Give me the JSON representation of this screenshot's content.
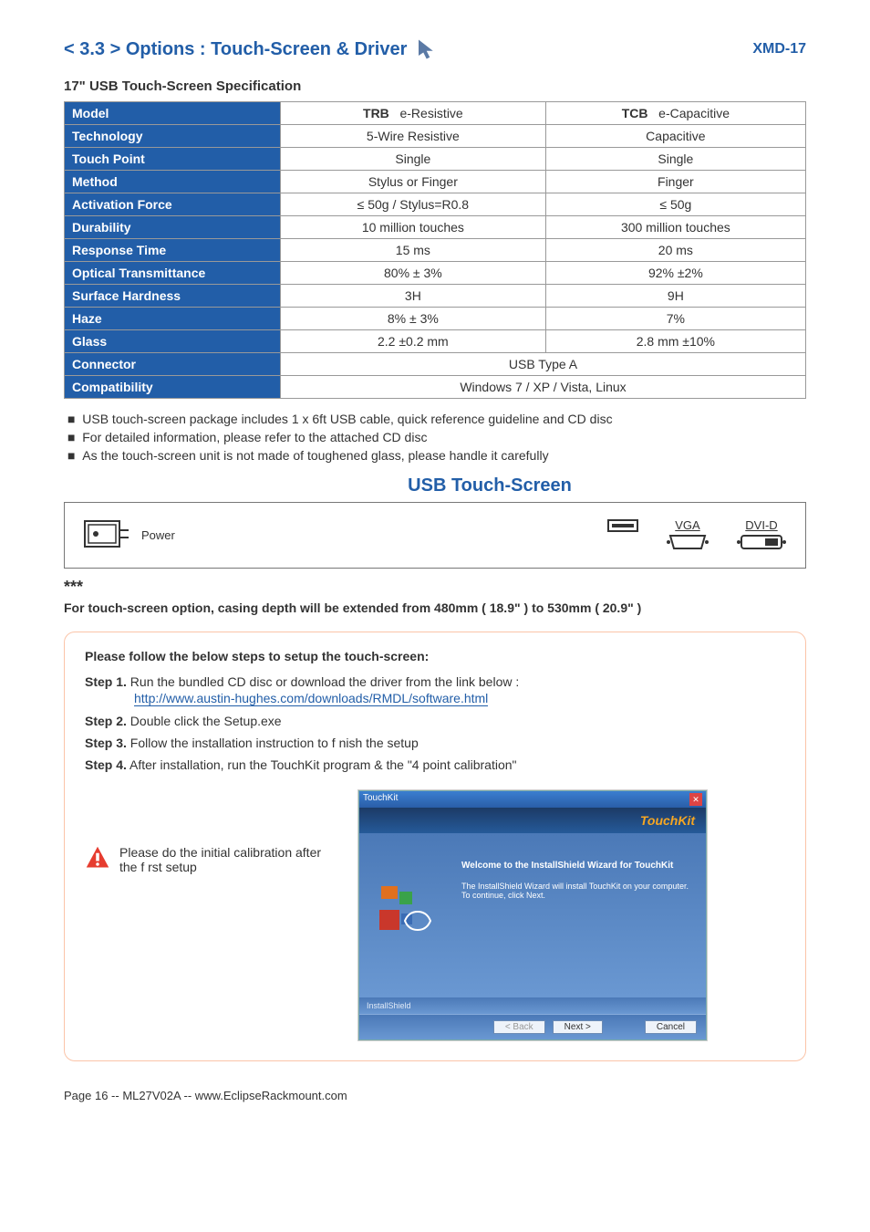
{
  "header": {
    "section_title": "< 3.3 > Options : Touch-Screen & Driver",
    "model_code": "XMD-17"
  },
  "spec_heading": "17\" USB Touch-Screen Specification",
  "table": {
    "rows": [
      {
        "label": "Model",
        "col1_bold": "TRB",
        "col1_rest": "e-Resistive",
        "col2_bold": "TCB",
        "col2_rest": "e-Capacitive"
      },
      {
        "label": "Technology",
        "col1": "5-Wire Resistive",
        "col2": "Capacitive"
      },
      {
        "label": "Touch Point",
        "col1": "Single",
        "col2": "Single"
      },
      {
        "label": "Method",
        "col1": "Stylus or Finger",
        "col2": "Finger"
      },
      {
        "label": "Activation Force",
        "col1": "≤ 50g / Stylus=R0.8",
        "col2": "≤ 50g"
      },
      {
        "label": "Durability",
        "col1": "10 million touches",
        "col2": "300 million touches"
      },
      {
        "label": "Response Time",
        "col1": "15 ms",
        "col2": "20 ms"
      },
      {
        "label": "Optical Transmittance",
        "col1": "80% ± 3%",
        "col2": "92% ±2%"
      },
      {
        "label": "Surface Hardness",
        "col1": "3H",
        "col2": "9H"
      },
      {
        "label": "Haze",
        "col1": "8% ± 3%",
        "col2": "7%"
      },
      {
        "label": "Glass",
        "col1": "2.2 ±0.2 mm",
        "col2": "2.8 mm ±10%"
      },
      {
        "label": "Connector",
        "span": "USB Type A"
      },
      {
        "label": "Compatibility",
        "span": "Windows 7 / XP / Vista, Linux"
      }
    ]
  },
  "bullets": [
    "USB touch-screen package includes 1 x 6ft USB cable, quick reference guideline and CD disc",
    "For detailed information, please refer to the attached CD disc",
    "As the touch-screen unit is not made of toughened glass, please handle it carefully"
  ],
  "usb_heading": "USB Touch-Screen",
  "diagram": {
    "power_label": "Power",
    "dvi_label": "DVI-D",
    "vga_label": "VGA"
  },
  "stars": "***",
  "depth_note": "For touch-screen option, casing depth will be extended from 480mm ( 18.9\" ) to 530mm ( 20.9\" )",
  "steps": {
    "title": "Please follow the below steps to setup the touch-screen:",
    "items": [
      {
        "label": "Step 1.",
        "text": "Run the bundled CD disc or download the driver from the link below :"
      },
      {
        "label": "Step 2.",
        "text": "Double click the Setup.exe"
      },
      {
        "label": "Step 3.",
        "text": "Follow the installation instruction to f nish the setup"
      },
      {
        "label": "Step 4.",
        "text": "After installation, run the TouchKit program & the \"4 point calibration\""
      }
    ],
    "download_link": "http://www.austin-hughes.com/downloads/RMDL/software.html",
    "calibration_note": "Please do the initial calibration after the f rst setup"
  },
  "installer": {
    "title": "TouchKit",
    "brand": "TouchKit",
    "welcome_heading": "Welcome to the InstallShield Wizard for TouchKit",
    "welcome_text": "The InstallShield Wizard will install TouchKit on your computer. To continue, click Next.",
    "installshield": "InstallShield",
    "btn_back": "< Back",
    "btn_next": "Next >",
    "btn_cancel": "Cancel"
  },
  "footer": "Page 16 -- ML27V02A -- www.EclipseRackmount.com"
}
